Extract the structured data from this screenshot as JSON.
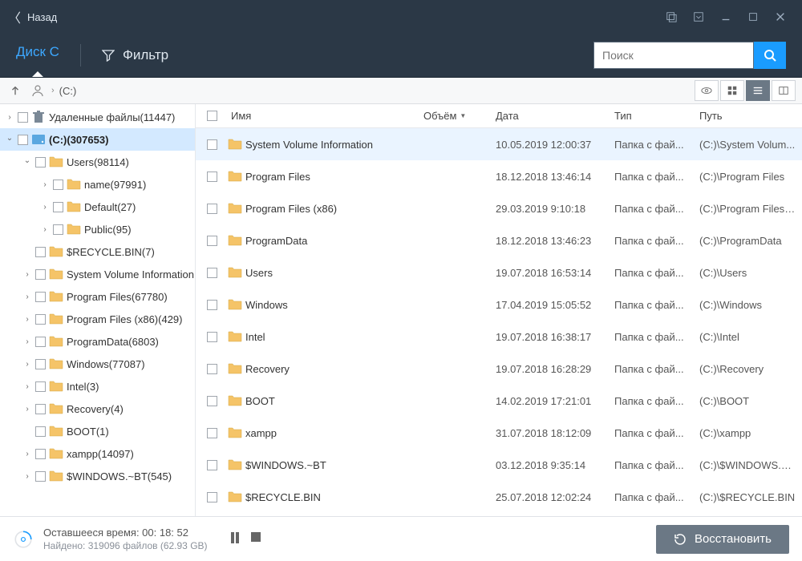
{
  "titlebar": {
    "back_label": "Назад"
  },
  "toolbar": {
    "disk_label": "Диск C",
    "filter_label": "Фильтр",
    "search_placeholder": "Поиск"
  },
  "crumb": {
    "path": "(C:)"
  },
  "columns": {
    "name": "Имя",
    "size": "Объём",
    "date": "Дата",
    "type": "Тип",
    "path": "Путь"
  },
  "tree": [
    {
      "depth": 0,
      "arrow": "right",
      "icon": "trash",
      "label": "Удаленные файлы(11447)",
      "selected": false
    },
    {
      "depth": 0,
      "arrow": "down",
      "icon": "disk",
      "label": "(C:)(307653)",
      "selected": true
    },
    {
      "depth": 1,
      "arrow": "down",
      "icon": "folder",
      "label": "Users(98114)",
      "selected": false
    },
    {
      "depth": 2,
      "arrow": "right",
      "icon": "folder",
      "label": "name(97991)",
      "selected": false
    },
    {
      "depth": 2,
      "arrow": "right",
      "icon": "folder",
      "label": "Default(27)",
      "selected": false
    },
    {
      "depth": 2,
      "arrow": "right",
      "icon": "folder",
      "label": "Public(95)",
      "selected": false
    },
    {
      "depth": 1,
      "arrow": "none",
      "icon": "folder",
      "label": "$RECYCLE.BIN(7)",
      "selected": false
    },
    {
      "depth": 1,
      "arrow": "right",
      "icon": "folder",
      "label": "System Volume Information",
      "selected": false
    },
    {
      "depth": 1,
      "arrow": "right",
      "icon": "folder",
      "label": "Program Files(67780)",
      "selected": false
    },
    {
      "depth": 1,
      "arrow": "right",
      "icon": "folder",
      "label": "Program Files (x86)(429)",
      "selected": false
    },
    {
      "depth": 1,
      "arrow": "right",
      "icon": "folder",
      "label": "ProgramData(6803)",
      "selected": false
    },
    {
      "depth": 1,
      "arrow": "right",
      "icon": "folder",
      "label": "Windows(77087)",
      "selected": false
    },
    {
      "depth": 1,
      "arrow": "right",
      "icon": "folder",
      "label": "Intel(3)",
      "selected": false
    },
    {
      "depth": 1,
      "arrow": "right",
      "icon": "folder",
      "label": "Recovery(4)",
      "selected": false
    },
    {
      "depth": 1,
      "arrow": "none",
      "icon": "folder",
      "label": "BOOT(1)",
      "selected": false
    },
    {
      "depth": 1,
      "arrow": "right",
      "icon": "folder",
      "label": "xampp(14097)",
      "selected": false
    },
    {
      "depth": 1,
      "arrow": "right",
      "icon": "folder",
      "label": "$WINDOWS.~BT(545)",
      "selected": false
    }
  ],
  "files": [
    {
      "name": "System Volume Information",
      "date": "10.05.2019 12:00:37",
      "type": "Папка с фай...",
      "path": "(C:)\\System Volum...",
      "selected": true
    },
    {
      "name": "Program Files",
      "date": "18.12.2018 13:46:14",
      "type": "Папка с фай...",
      "path": "(C:)\\Program Files",
      "selected": false
    },
    {
      "name": "Program Files (x86)",
      "date": "29.03.2019 9:10:18",
      "type": "Папка с фай...",
      "path": "(C:)\\Program Files (...",
      "selected": false
    },
    {
      "name": "ProgramData",
      "date": "18.12.2018 13:46:23",
      "type": "Папка с фай...",
      "path": "(C:)\\ProgramData",
      "selected": false
    },
    {
      "name": "Users",
      "date": "19.07.2018 16:53:14",
      "type": "Папка с фай...",
      "path": "(C:)\\Users",
      "selected": false
    },
    {
      "name": "Windows",
      "date": "17.04.2019 15:05:52",
      "type": "Папка с фай...",
      "path": "(C:)\\Windows",
      "selected": false
    },
    {
      "name": "Intel",
      "date": "19.07.2018 16:38:17",
      "type": "Папка с фай...",
      "path": "(C:)\\Intel",
      "selected": false
    },
    {
      "name": "Recovery",
      "date": "19.07.2018 16:28:29",
      "type": "Папка с фай...",
      "path": "(C:)\\Recovery",
      "selected": false
    },
    {
      "name": "BOOT",
      "date": "14.02.2019 17:21:01",
      "type": "Папка с фай...",
      "path": "(C:)\\BOOT",
      "selected": false
    },
    {
      "name": "xampp",
      "date": "31.07.2018 18:12:09",
      "type": "Папка с фай...",
      "path": "(C:)\\xampp",
      "selected": false
    },
    {
      "name": "$WINDOWS.~BT",
      "date": "03.12.2018 9:35:14",
      "type": "Папка с фай...",
      "path": "(C:)\\$WINDOWS.~...",
      "selected": false
    },
    {
      "name": "$RECYCLE.BIN",
      "date": "25.07.2018 12:02:24",
      "type": "Папка с фай...",
      "path": "(C:)\\$RECYCLE.BIN",
      "selected": false
    }
  ],
  "status": {
    "remaining": "Оставшееся время: 00: 18: 52",
    "found": "Найдено: 319096 файлов (62.93 GB)",
    "recover_label": "Восстановить"
  }
}
